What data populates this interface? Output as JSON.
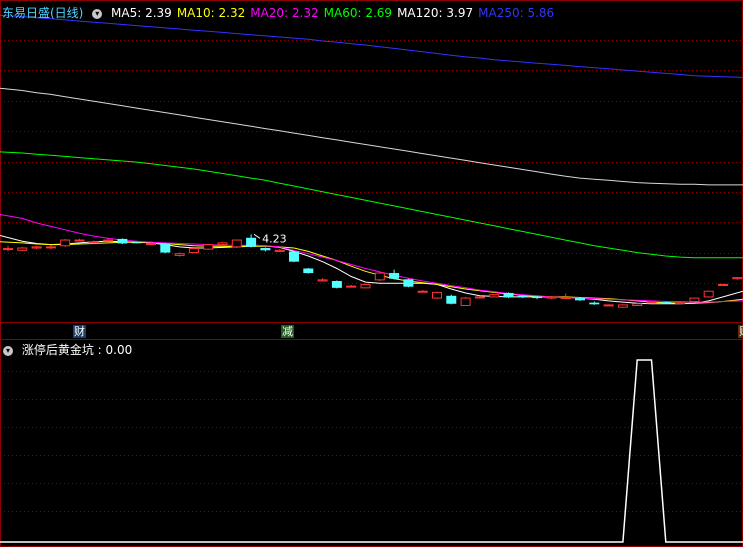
{
  "header": {
    "title": "东易日盛(日线)",
    "menu_icon": "chevron-down-icon",
    "ma": [
      {
        "label": "MA5: 2.39",
        "color": "#ffffff"
      },
      {
        "label": "MA10: 2.32",
        "color": "#ffff00"
      },
      {
        "label": "MA20: 2.32",
        "color": "#ff00ff"
      },
      {
        "label": "MA60: 2.69",
        "color": "#00ff00"
      },
      {
        "label": "MA120: 3.97",
        "color": "#ffffff"
      },
      {
        "label": "MA250: 5.86",
        "color": "#3333ff"
      }
    ]
  },
  "indicator": {
    "menu_icon": "chevron-down-icon",
    "label": "涨停后黄金坑 : 0.00"
  },
  "markers": [
    {
      "text": "财",
      "bg": "#1c3d6b",
      "color": "#ffffff"
    },
    {
      "text": "减",
      "bg": "#1f5e1f",
      "color": "#ffffff"
    },
    {
      "text": "财",
      "bg": "#5a2a00",
      "color": "#ffffff"
    }
  ],
  "colors": {
    "up": "#ff3333",
    "down": "#55ffff",
    "grid": "#8b0000",
    "title": "#4fd2ff",
    "indicator": "#ffffff"
  },
  "chart_data": {
    "type": "candlestick",
    "annotation": {
      "label": "4.23",
      "value": 4.23
    },
    "candles": [
      [
        2.85,
        2.85,
        2.9,
        2.8
      ],
      [
        2.82,
        2.86,
        2.88,
        2.81
      ],
      [
        2.86,
        2.88,
        2.9,
        2.84
      ],
      [
        2.88,
        2.88,
        2.91,
        2.84
      ],
      [
        2.9,
        3.0,
        3.02,
        2.88
      ],
      [
        3.0,
        3.0,
        3.02,
        2.98
      ],
      [
        2.96,
        2.97,
        2.99,
        2.95
      ],
      [
        3.0,
        3.0,
        3.03,
        2.97
      ],
      [
        3.02,
        2.94,
        3.03,
        2.93
      ],
      [
        2.96,
        2.95,
        2.97,
        2.94
      ],
      [
        2.94,
        2.94,
        2.96,
        2.92
      ],
      [
        2.94,
        2.78,
        2.95,
        2.77
      ],
      [
        2.73,
        2.76,
        2.78,
        2.71
      ],
      [
        2.78,
        2.85,
        2.86,
        2.77
      ],
      [
        2.84,
        2.92,
        2.93,
        2.83
      ],
      [
        2.92,
        2.95,
        2.97,
        2.91
      ],
      [
        2.88,
        3.0,
        3.01,
        2.86
      ],
      [
        3.04,
        2.88,
        3.1,
        2.87
      ],
      [
        2.86,
        2.82,
        2.87,
        2.8
      ],
      [
        2.8,
        2.82,
        2.84,
        2.79
      ],
      [
        2.8,
        2.62,
        2.81,
        2.61
      ],
      [
        2.5,
        2.42,
        2.51,
        2.41
      ],
      [
        2.28,
        2.3,
        2.33,
        2.27
      ],
      [
        2.28,
        2.16,
        2.29,
        2.15
      ],
      [
        2.19,
        2.19,
        2.21,
        2.17
      ],
      [
        2.16,
        2.22,
        2.23,
        2.15
      ],
      [
        2.3,
        2.42,
        2.44,
        2.28
      ],
      [
        2.42,
        2.32,
        2.48,
        2.31
      ],
      [
        2.31,
        2.18,
        2.32,
        2.17
      ],
      [
        2.1,
        2.1,
        2.12,
        2.08
      ],
      [
        1.98,
        2.08,
        2.09,
        1.97
      ],
      [
        2.02,
        1.88,
        2.04,
        1.87
      ],
      [
        1.85,
        1.98,
        2.0,
        1.84
      ],
      [
        1.99,
        2.0,
        2.02,
        1.97
      ],
      [
        2.0,
        2.04,
        2.05,
        1.99
      ],
      [
        2.07,
        1.99,
        2.08,
        1.98
      ],
      [
        2.02,
        2.0,
        2.03,
        1.98
      ],
      [
        2.01,
        1.98,
        2.02,
        1.96
      ],
      [
        1.98,
        2.0,
        2.01,
        1.96
      ],
      [
        1.99,
        1.99,
        2.06,
        1.98
      ],
      [
        1.98,
        1.94,
        1.99,
        1.93
      ],
      [
        1.9,
        1.87,
        1.92,
        1.86
      ],
      [
        1.86,
        1.86,
        1.87,
        1.84
      ],
      [
        1.82,
        1.86,
        1.87,
        1.81
      ],
      [
        1.85,
        1.88,
        1.89,
        1.84
      ],
      [
        1.9,
        1.91,
        1.92,
        1.89
      ],
      [
        1.91,
        1.89,
        1.92,
        1.88
      ],
      [
        1.89,
        1.9,
        1.92,
        1.88
      ],
      [
        1.92,
        1.98,
        1.99,
        1.91
      ],
      [
        2.0,
        2.1,
        2.11,
        1.99
      ],
      [
        2.22,
        2.22,
        2.23,
        2.21
      ],
      [
        2.32,
        2.34,
        2.35,
        2.3
      ]
    ],
    "indicator_values": [
      0,
      0,
      0,
      0,
      0,
      0,
      0,
      0,
      0,
      0,
      0,
      0,
      0,
      0,
      0,
      0,
      0,
      0,
      0,
      0,
      0,
      0,
      0,
      0,
      0,
      0,
      0,
      0,
      0,
      0,
      0,
      0,
      0,
      0,
      0,
      0,
      0,
      0,
      0,
      0,
      0,
      0,
      0,
      0,
      1,
      1,
      0,
      0,
      0,
      0,
      0,
      0
    ],
    "ma_lines": {
      "MA5": [
        3.08,
        2.98,
        2.94,
        2.92,
        2.93,
        2.95,
        2.97,
        2.98,
        2.97,
        2.96,
        2.95,
        2.92,
        2.88,
        2.86,
        2.86,
        2.87,
        2.88,
        2.91,
        2.9,
        2.87,
        2.8,
        2.72,
        2.62,
        2.5,
        2.36,
        2.26,
        2.24,
        2.24,
        2.24,
        2.24,
        2.22,
        2.14,
        2.07,
        2.02,
        2.01,
        2.0,
        2.0,
        2.0,
        2.0,
        1.99,
        1.98,
        1.96,
        1.93,
        1.91,
        1.89,
        1.88,
        1.88,
        1.88,
        1.89,
        1.93,
        2.0,
        2.1
      ],
      "MA10": [
        2.97,
        2.95,
        2.93,
        2.92,
        2.92,
        2.93,
        2.94,
        2.95,
        2.96,
        2.96,
        2.96,
        2.94,
        2.92,
        2.9,
        2.89,
        2.89,
        2.88,
        2.89,
        2.89,
        2.88,
        2.86,
        2.8,
        2.72,
        2.64,
        2.54,
        2.45,
        2.38,
        2.32,
        2.28,
        2.25,
        2.22,
        2.18,
        2.14,
        2.11,
        2.08,
        2.05,
        2.03,
        2.01,
        2.0,
        2.0,
        1.99,
        1.98,
        1.97,
        1.95,
        1.93,
        1.91,
        1.9,
        1.89,
        1.89,
        1.9,
        1.92,
        1.96
      ],
      "MA20": [
        3.45,
        3.38,
        3.3,
        3.24,
        3.18,
        3.12,
        3.07,
        3.03,
        3.0,
        2.98,
        2.96,
        2.95,
        2.94,
        2.93,
        2.92,
        2.91,
        2.91,
        2.91,
        2.9,
        2.88,
        2.82,
        2.76,
        2.7,
        2.64,
        2.57,
        2.5,
        2.44,
        2.38,
        2.33,
        2.28,
        2.24,
        2.2,
        2.16,
        2.12,
        2.09,
        2.06,
        2.04,
        2.02,
        2.0,
        1.99,
        1.98,
        1.97,
        1.96,
        1.95,
        1.94,
        1.93,
        1.92,
        1.92,
        1.91,
        1.91,
        1.92,
        1.93
      ],
      "MA60": [
        4.55,
        4.53,
        4.51,
        4.49,
        4.47,
        4.45,
        4.43,
        4.41,
        4.39,
        4.37,
        4.34,
        4.31,
        4.28,
        4.25,
        4.21,
        4.17,
        4.13,
        4.09,
        4.05,
        4.0,
        3.95,
        3.9,
        3.85,
        3.8,
        3.75,
        3.7,
        3.65,
        3.6,
        3.55,
        3.5,
        3.45,
        3.4,
        3.35,
        3.3,
        3.25,
        3.2,
        3.15,
        3.1,
        3.05,
        3.0,
        2.95,
        2.9,
        2.86,
        2.82,
        2.78,
        2.75,
        2.72,
        2.7,
        2.69,
        2.69,
        2.69,
        2.69
      ],
      "MA120": [
        5.67,
        5.63,
        5.59,
        5.56,
        5.52,
        5.48,
        5.44,
        5.4,
        5.36,
        5.32,
        5.28,
        5.24,
        5.2,
        5.16,
        5.12,
        5.08,
        5.04,
        5.0,
        4.96,
        4.92,
        4.88,
        4.84,
        4.8,
        4.76,
        4.72,
        4.68,
        4.64,
        4.6,
        4.56,
        4.52,
        4.48,
        4.44,
        4.4,
        4.36,
        4.32,
        4.28,
        4.24,
        4.2,
        4.16,
        4.12,
        4.09,
        4.07,
        4.05,
        4.03,
        4.01,
        4.0,
        3.99,
        3.98,
        3.98,
        3.97,
        3.97,
        3.97
      ],
      "MA250": [
        6.95,
        6.93,
        6.91,
        6.89,
        6.87,
        6.85,
        6.83,
        6.81,
        6.79,
        6.77,
        6.75,
        6.73,
        6.71,
        6.69,
        6.67,
        6.65,
        6.63,
        6.61,
        6.59,
        6.57,
        6.55,
        6.53,
        6.5,
        6.48,
        6.45,
        6.43,
        6.4,
        6.37,
        6.34,
        6.31,
        6.28,
        6.25,
        6.22,
        6.2,
        6.17,
        6.15,
        6.13,
        6.11,
        6.09,
        6.07,
        6.05,
        6.03,
        6.01,
        5.99,
        5.97,
        5.95,
        5.93,
        5.91,
        5.89,
        5.88,
        5.87,
        5.86
      ]
    }
  }
}
